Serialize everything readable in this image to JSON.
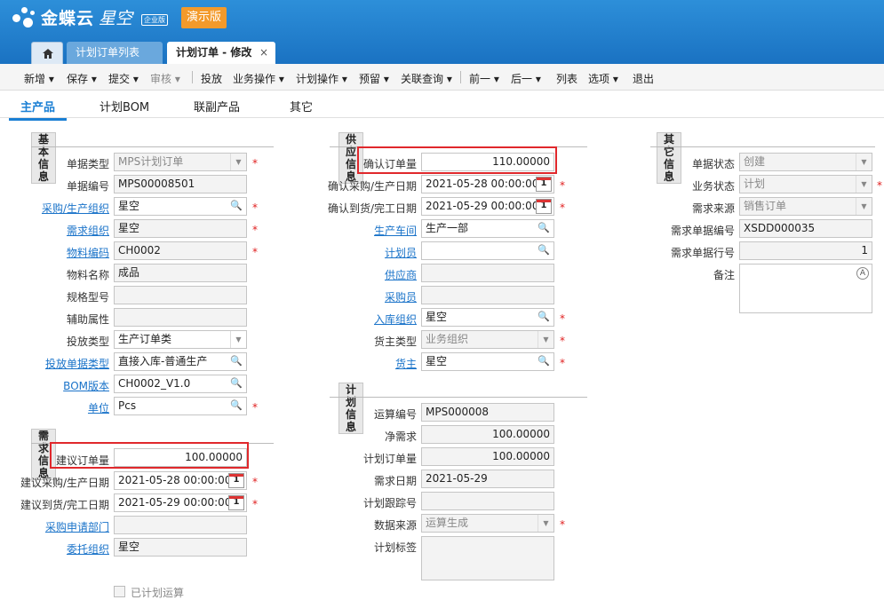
{
  "app": {
    "brand": "金蝶云",
    "product": "星空",
    "edition": "企业版",
    "demo_label": "演示版"
  },
  "tabs": {
    "home_icon": "home-icon",
    "list": "计划订单列表",
    "edit": "计划订单 - 修改",
    "close": "×"
  },
  "toolbar": [
    "新增 ▾",
    "保存 ▾",
    "提交 ▾",
    "审核 ▾",
    "投放",
    "业务操作 ▾",
    "计划操作 ▾",
    "预留 ▾",
    "关联查询 ▾",
    "前一 ▾",
    "后一 ▾",
    "列表",
    "选项 ▾",
    "退出"
  ],
  "subtabs": [
    "主产品",
    "计划BOM",
    "联副产品",
    "其它"
  ],
  "sections": {
    "basic": "基本信息",
    "demand": "需求信息",
    "supply": "供应信息",
    "plan": "计划信息",
    "other": "其它信息"
  },
  "basic": [
    {
      "label": "单据类型",
      "value": "MPS计划订单"
    },
    {
      "label": "单据编号",
      "value": "MPS00008501"
    },
    {
      "label": "采购/生产组织",
      "value": "星空"
    },
    {
      "label": "需求组织",
      "value": "星空"
    },
    {
      "label": "物料编码",
      "value": "CH0002"
    },
    {
      "label": "物料名称",
      "value": "成品"
    },
    {
      "label": "规格型号",
      "value": ""
    },
    {
      "label": "辅助属性",
      "value": ""
    },
    {
      "label": "投放类型",
      "value": "生产订单类"
    },
    {
      "label": "投放单据类型",
      "value": "直接入库-普通生产"
    },
    {
      "label": "BOM版本",
      "value": "CH0002_V1.0"
    },
    {
      "label": "单位",
      "value": "Pcs"
    }
  ],
  "demand": [
    {
      "label": "建议订单量",
      "value": "100.00000"
    },
    {
      "label": "建议采购/生产日期",
      "value": "2021-05-28 00:00:00"
    },
    {
      "label": "建议到货/完工日期",
      "value": "2021-05-29 00:00:00"
    },
    {
      "label": "采购申请部门",
      "value": ""
    },
    {
      "label": "委托组织",
      "value": "星空"
    }
  ],
  "checkbox_label": "已计划运算",
  "supply": [
    {
      "label": "确认订单量",
      "value": "110.00000"
    },
    {
      "label": "确认采购/生产日期",
      "value": "2021-05-28 00:00:00"
    },
    {
      "label": "确认到货/完工日期",
      "value": "2021-05-29 00:00:00"
    },
    {
      "label": "生产车间",
      "value": "生产一部"
    },
    {
      "label": "计划员",
      "value": ""
    },
    {
      "label": "供应商",
      "value": ""
    },
    {
      "label": "采购员",
      "value": ""
    },
    {
      "label": "入库组织",
      "value": "星空"
    },
    {
      "label": "货主类型",
      "value": "业务组织"
    },
    {
      "label": "货主",
      "value": "星空"
    }
  ],
  "plan": [
    {
      "label": "运算编号",
      "value": "MPS000008"
    },
    {
      "label": "净需求",
      "value": "100.00000"
    },
    {
      "label": "计划订单量",
      "value": "100.00000"
    },
    {
      "label": "需求日期",
      "value": "2021-05-29"
    },
    {
      "label": "计划跟踪号",
      "value": ""
    },
    {
      "label": "数据来源",
      "value": "运算生成"
    },
    {
      "label": "计划标签",
      "value": ""
    }
  ],
  "other": [
    {
      "label": "单据状态",
      "value": "创建"
    },
    {
      "label": "业务状态",
      "value": "计划"
    },
    {
      "label": "需求来源",
      "value": "销售订单"
    },
    {
      "label": "需求单据编号",
      "value": "XSDD000035"
    },
    {
      "label": "需求单据行号",
      "value": "1"
    },
    {
      "label": "备注",
      "value": ""
    }
  ]
}
